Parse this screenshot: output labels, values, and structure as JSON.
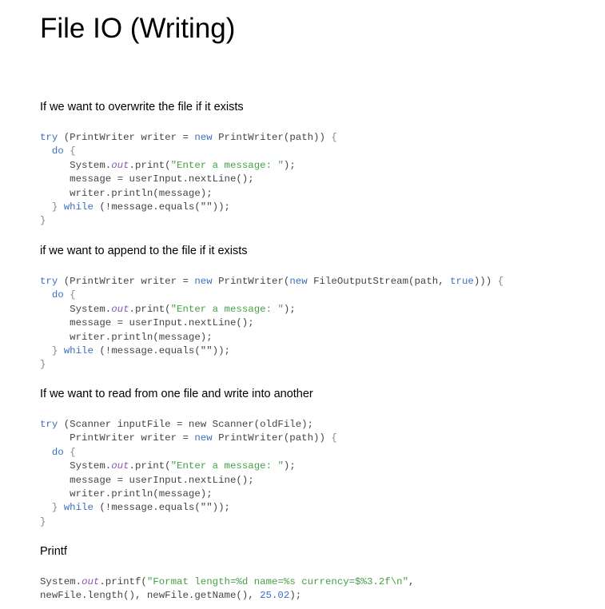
{
  "title": "File IO (Writing)",
  "sections": [
    {
      "heading": "If we want to overwrite the file if it exists",
      "code": [
        [
          {
            "t": "try",
            "c": "kw"
          },
          {
            "t": " (PrintWriter writer = "
          },
          {
            "t": "new",
            "c": "kw"
          },
          {
            "t": " PrintWriter(path)) "
          },
          {
            "t": "{",
            "c": "brace"
          }
        ],
        [
          {
            "t": "  "
          },
          {
            "t": "do",
            "c": "kw"
          },
          {
            "t": " "
          },
          {
            "t": "{",
            "c": "brace"
          }
        ],
        [
          {
            "t": "     System."
          },
          {
            "t": "out",
            "c": "fld"
          },
          {
            "t": ".print("
          },
          {
            "t": "\"Enter a message: \"",
            "c": "str"
          },
          {
            "t": ");"
          }
        ],
        [
          {
            "t": "     message = userInput.nextLine();"
          }
        ],
        [
          {
            "t": "     writer.println(message);"
          }
        ],
        [
          {
            "t": "  "
          },
          {
            "t": "}",
            "c": "brace"
          },
          {
            "t": " "
          },
          {
            "t": "while",
            "c": "kw"
          },
          {
            "t": " (!message.equals(\"\"));"
          }
        ],
        [
          {
            "t": "}",
            "c": "brace"
          }
        ]
      ]
    },
    {
      "heading": "if we want to append to the file if it exists",
      "code": [
        [
          {
            "t": "try",
            "c": "kw"
          },
          {
            "t": " (PrintWriter writer = "
          },
          {
            "t": "new",
            "c": "kw"
          },
          {
            "t": " PrintWriter("
          },
          {
            "t": "new",
            "c": "kw"
          },
          {
            "t": " FileOutputStream(path, "
          },
          {
            "t": "true",
            "c": "kw"
          },
          {
            "t": "))) "
          },
          {
            "t": "{",
            "c": "brace"
          }
        ],
        [
          {
            "t": "  "
          },
          {
            "t": "do",
            "c": "kw"
          },
          {
            "t": " "
          },
          {
            "t": "{",
            "c": "brace"
          }
        ],
        [
          {
            "t": "     System."
          },
          {
            "t": "out",
            "c": "fld"
          },
          {
            "t": ".print("
          },
          {
            "t": "\"Enter a message: \"",
            "c": "str"
          },
          {
            "t": ");"
          }
        ],
        [
          {
            "t": "     message = userInput.nextLine();"
          }
        ],
        [
          {
            "t": "     writer.println(message);"
          }
        ],
        [
          {
            "t": "  "
          },
          {
            "t": "}",
            "c": "brace"
          },
          {
            "t": " "
          },
          {
            "t": "while",
            "c": "kw"
          },
          {
            "t": " (!message.equals(\"\"));"
          }
        ],
        [
          {
            "t": "}",
            "c": "brace"
          }
        ]
      ]
    },
    {
      "heading": "If we want to read from one file and write into another",
      "code": [
        [
          {
            "t": "try",
            "c": "kw"
          },
          {
            "t": " (Scanner inputFile = new Scanner(oldFile);"
          }
        ],
        [
          {
            "t": "     PrintWriter writer = "
          },
          {
            "t": "new",
            "c": "kw"
          },
          {
            "t": " PrintWriter(path)) "
          },
          {
            "t": "{",
            "c": "brace"
          }
        ],
        [
          {
            "t": "  "
          },
          {
            "t": "do",
            "c": "kw"
          },
          {
            "t": " "
          },
          {
            "t": "{",
            "c": "brace"
          }
        ],
        [
          {
            "t": "     System."
          },
          {
            "t": "out",
            "c": "fld"
          },
          {
            "t": ".print("
          },
          {
            "t": "\"Enter a message: \"",
            "c": "str"
          },
          {
            "t": ");"
          }
        ],
        [
          {
            "t": "     message = userInput.nextLine();"
          }
        ],
        [
          {
            "t": "     writer.println(message);"
          }
        ],
        [
          {
            "t": "  "
          },
          {
            "t": "}",
            "c": "brace"
          },
          {
            "t": " "
          },
          {
            "t": "while",
            "c": "kw"
          },
          {
            "t": " (!message.equals(\"\"));"
          }
        ],
        [
          {
            "t": "}",
            "c": "brace"
          }
        ]
      ]
    },
    {
      "heading": "Printf",
      "code": [
        [
          {
            "t": "System."
          },
          {
            "t": "out",
            "c": "fld"
          },
          {
            "t": ".printf("
          },
          {
            "t": "\"Format length=%d name=%s currency=$%3.2f\\n\"",
            "c": "str"
          },
          {
            "t": ","
          }
        ],
        [
          {
            "t": "newFile.length(), newFile.getName(), "
          },
          {
            "t": "25.02",
            "c": "num"
          },
          {
            "t": ");"
          }
        ]
      ]
    }
  ]
}
